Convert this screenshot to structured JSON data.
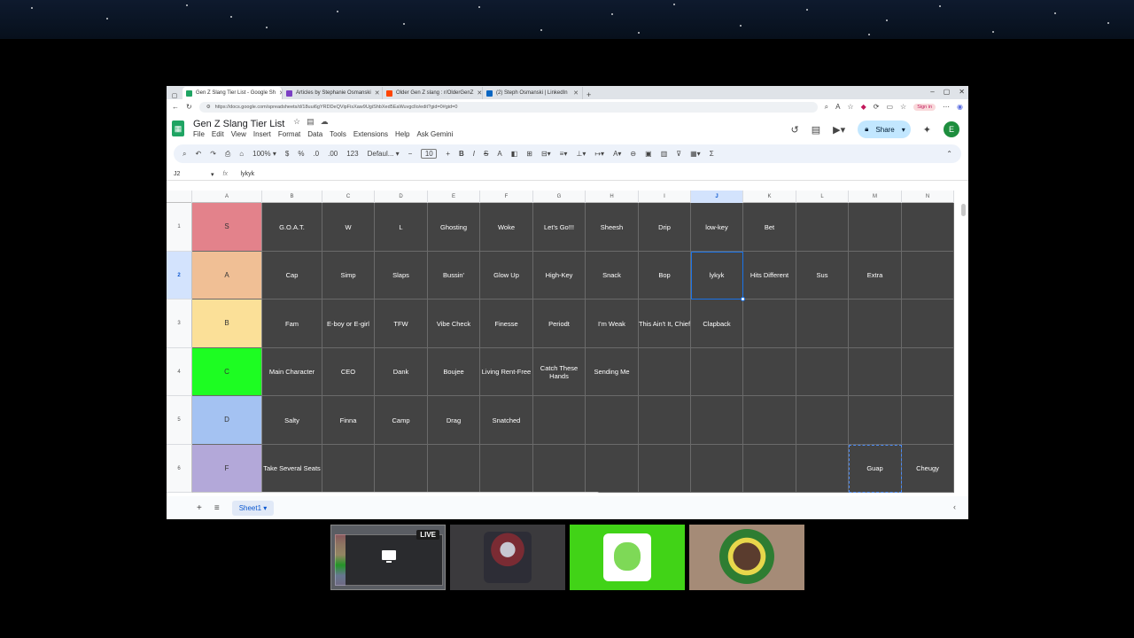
{
  "browser": {
    "tabs": [
      {
        "label": "Gen Z Slang Tier List - Google Sh",
        "favicon_color": "#1fa463",
        "active": true
      },
      {
        "label": "Articles by Stephanie Osmanski",
        "favicon_color": "#7b3fc4",
        "active": false
      },
      {
        "label": "Older Gen Z slang : r/OlderGenZ",
        "favicon_color": "#ff4500",
        "active": false
      },
      {
        "label": "(2) Steph Osmanski | LinkedIn",
        "favicon_color": "#0a66c2",
        "active": false
      }
    ],
    "url": "https://docs.google.com/spreadsheets/d/18uui6gYRDDeQVipFisXaw9UgiShbXed5EaWuvgcllo/edit?gid=0#gid=0",
    "signin_label": "Sign in"
  },
  "sheets": {
    "doc_title": "Gen Z Slang Tier List",
    "menu": [
      "File",
      "Edit",
      "View",
      "Insert",
      "Format",
      "Data",
      "Tools",
      "Extensions",
      "Help",
      "Ask Gemini"
    ],
    "share_label": "Share",
    "avatar_letter": "E",
    "toolbar": {
      "zoom": "100%",
      "currency": "$",
      "percent": "%",
      "dec_decrease": ".0",
      "dec_increase": ".00",
      "number_format": "123",
      "font": "Defaul...",
      "font_size": "10"
    },
    "name_box": "J2",
    "formula_value": "lykyk",
    "sheet_tab": "Sheet1"
  },
  "grid": {
    "columns": [
      "A",
      "B",
      "C",
      "D",
      "E",
      "F",
      "G",
      "H",
      "I",
      "J",
      "K",
      "L",
      "M",
      "N"
    ],
    "selected_column": "J",
    "selected_row": "2",
    "rows": [
      {
        "num": "1",
        "tier": "S",
        "color": "#e3828b",
        "items": [
          "G.O.A.T.",
          "W",
          "L",
          "Ghosting",
          "Woke",
          "Let's Go!!!",
          "Sheesh",
          "Drip",
          "low-key",
          "Bet",
          "",
          "",
          ""
        ]
      },
      {
        "num": "2",
        "tier": "A",
        "color": "#f0bf95",
        "items": [
          "Cap",
          "Simp",
          "Slaps",
          "Bussin'",
          "Glow Up",
          "High-Key",
          "Snack",
          "Bop",
          "lykyk",
          "Hits Different",
          "Sus",
          "Extra",
          ""
        ]
      },
      {
        "num": "3",
        "tier": "B",
        "color": "#fbe098",
        "items": [
          "Fam",
          "E-boy or E-girl",
          "TFW",
          "Vibe Check",
          "Finesse",
          "Periodt",
          "I'm Weak",
          "This Ain't It, Chief",
          "Clapback",
          "",
          "",
          "",
          ""
        ]
      },
      {
        "num": "4",
        "tier": "C",
        "color": "#1dfd22",
        "items": [
          "Main Character",
          "CEO",
          "Dank",
          "Boujee",
          "Living Rent-Free",
          "Catch These Hands",
          "Sending Me",
          "",
          "",
          "",
          "",
          "",
          ""
        ]
      },
      {
        "num": "5",
        "tier": "D",
        "color": "#a4c2f2",
        "items": [
          "Salty",
          "Finna",
          "Camp",
          "Drag",
          "Snatched",
          "",
          "",
          "",
          "",
          "",
          "",
          "",
          ""
        ]
      },
      {
        "num": "6",
        "tier": "F",
        "color": "#b3a8d9",
        "items": [
          "Take Several Seats",
          "",
          "",
          "",
          "",
          "",
          "",
          "",
          "",
          "",
          "",
          "Guap",
          "Cheugy"
        ]
      }
    ]
  },
  "participants": {
    "live_label": "LIVE"
  }
}
